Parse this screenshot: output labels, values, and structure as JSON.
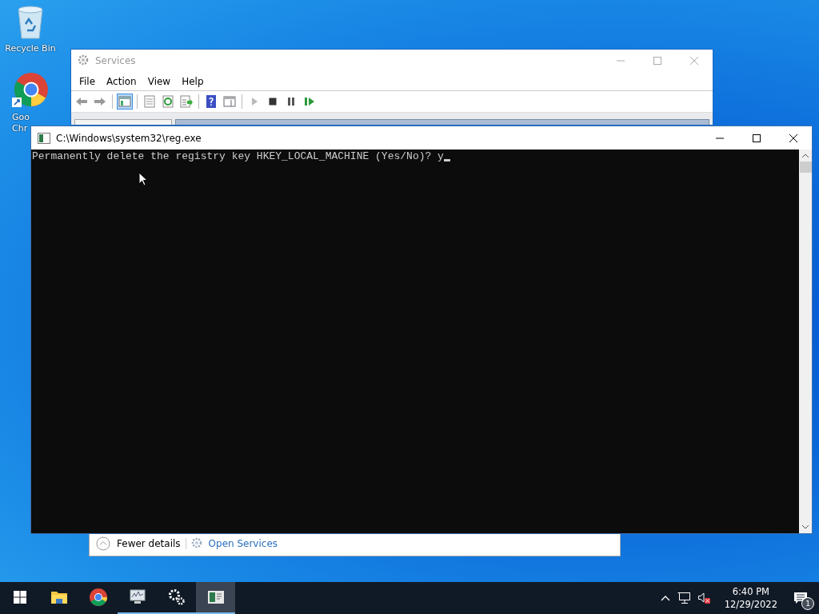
{
  "desktop": {
    "icons": [
      {
        "kind": "recycle-bin",
        "label_lines": [
          "Recycle Bin"
        ]
      },
      {
        "kind": "browser",
        "label_lines": [
          "Goo",
          "Chr"
        ]
      }
    ]
  },
  "services_window": {
    "title": "Services",
    "menu": [
      "File",
      "Action",
      "View",
      "Help"
    ],
    "toolbar": [
      {
        "kind": "back",
        "pressed": false
      },
      {
        "kind": "forward",
        "pressed": false
      },
      {
        "kind": "separator"
      },
      {
        "kind": "console-tree",
        "pressed": true
      },
      {
        "kind": "separator"
      },
      {
        "kind": "properties",
        "pressed": false
      },
      {
        "kind": "refresh",
        "pressed": false
      },
      {
        "kind": "export",
        "pressed": false
      },
      {
        "kind": "separator"
      },
      {
        "kind": "help",
        "pressed": false
      },
      {
        "kind": "action-pane",
        "pressed": false
      },
      {
        "kind": "separator"
      },
      {
        "kind": "play",
        "pressed": false
      },
      {
        "kind": "stop",
        "pressed": false
      },
      {
        "kind": "pause",
        "pressed": false
      },
      {
        "kind": "resume",
        "pressed": false
      }
    ]
  },
  "task_manager": {
    "details_toggle": "Fewer details",
    "link": "Open Services"
  },
  "console": {
    "title": "C:\\Windows\\system32\\reg.exe",
    "lines": [
      "Permanently delete the registry key HKEY_LOCAL_MACHINE (Yes/No)? y"
    ]
  },
  "taskbar": {
    "apps": [
      {
        "kind": "folder",
        "running": false,
        "active": false
      },
      {
        "kind": "browser",
        "running": false,
        "active": false
      },
      {
        "kind": "monitor",
        "running": true,
        "active": false
      },
      {
        "kind": "gears",
        "running": true,
        "active": false
      },
      {
        "kind": "console",
        "running": true,
        "active": true
      }
    ],
    "tray": {
      "time": "6:40 PM",
      "date": "12/29/2022",
      "notification_count": "1"
    }
  }
}
